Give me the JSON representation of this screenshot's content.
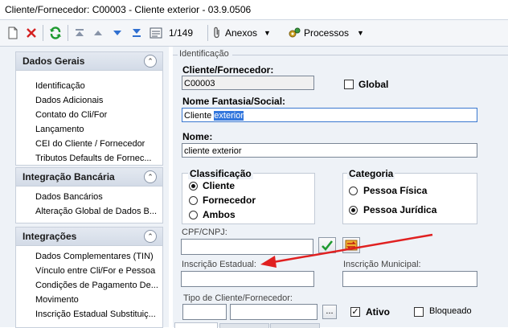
{
  "window": {
    "title": "Cliente/Fornecedor: C00003 - Cliente exterior - 03.9.0506"
  },
  "toolbar": {
    "record_counter": "1/149",
    "anexos_label": "Anexos",
    "processos_label": "Processos"
  },
  "sidebar": {
    "groups": [
      {
        "title": "Dados Gerais",
        "items": [
          "Identificação",
          "Dados Adicionais",
          "Contato do Cli/For",
          "Lançamento",
          "CEI do Cliente /  Fornecedor",
          "Tributos Defaults de Fornec..."
        ]
      },
      {
        "title": "Integração Bancária",
        "items": [
          "Dados Bancários",
          "Alteração Global de Dados B..."
        ]
      },
      {
        "title": "Integrações",
        "items": [
          "Dados Complementares (TIN)",
          "Vínculo entre Cli/For e Pessoa",
          "Condições de Pagamento De...",
          "Movimento",
          "Inscrição Estadual Substituiç..."
        ]
      }
    ]
  },
  "form": {
    "section_title": "Identificação",
    "cliente_label": "Cliente/Fornecedor:",
    "cliente_value": "C00003",
    "global_label": "Global",
    "nome_fantasia_label": "Nome Fantasia/Social:",
    "nome_fantasia_value_part1": "Cliente ",
    "nome_fantasia_value_selected": "exterior",
    "nome_label": "Nome:",
    "nome_value": "cliente exterior",
    "classificacao": {
      "title": "Classificação",
      "options": [
        "Cliente",
        "Fornecedor",
        "Ambos"
      ],
      "selected": "Cliente"
    },
    "categoria": {
      "title": "Categoria",
      "options": [
        "Pessoa Física",
        "Pessoa Jurídica"
      ],
      "selected": "Pessoa Jurídica"
    },
    "cpf_label": "CPF/CNPJ:",
    "cpf_value": "",
    "inscricao_estadual_label": "Inscrição Estadual:",
    "inscricao_estadual_value": "",
    "inscricao_municipal_label": "Inscrição Municipal:",
    "inscricao_municipal_value": "",
    "tipo_label": "Tipo de Cliente/Fornecedor:",
    "browse_label": "...",
    "ativo_label": "Ativo",
    "ativo_checked": true,
    "bloqueado_label": "Bloqueado",
    "bloqueado_checked": false
  },
  "annotation": {
    "color": "#e02020"
  }
}
